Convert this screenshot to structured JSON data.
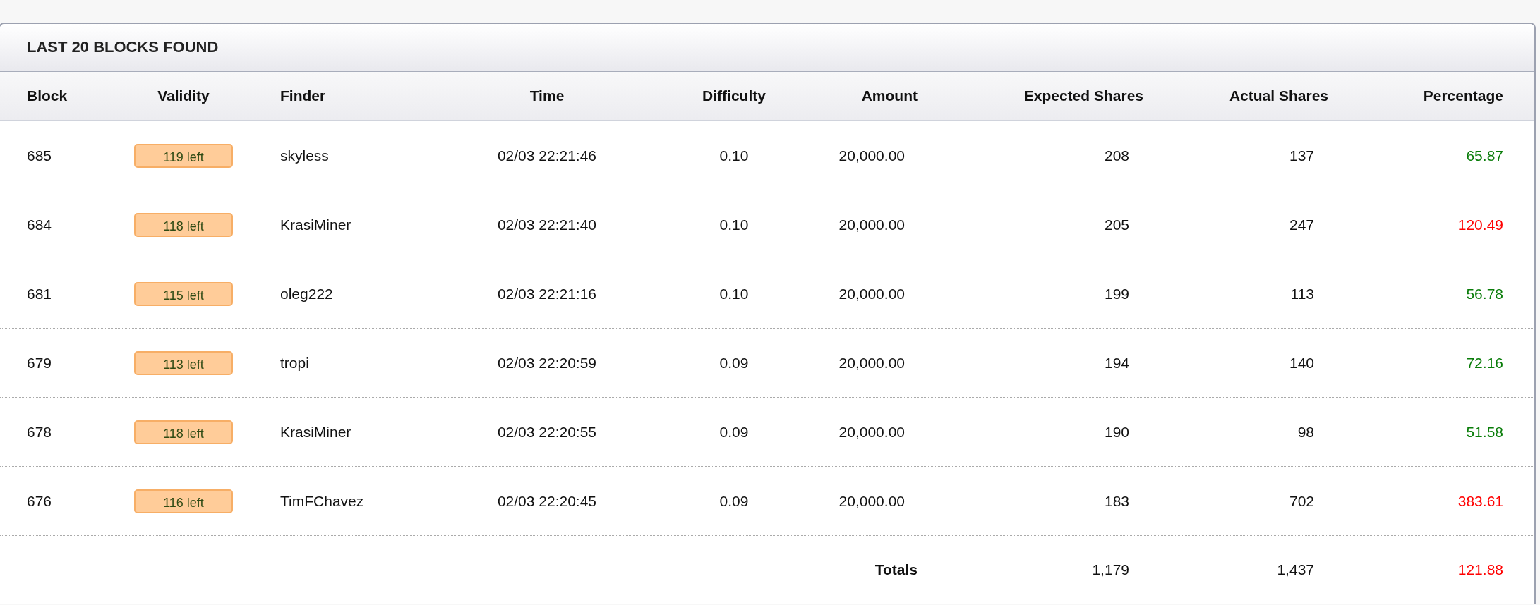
{
  "panel": {
    "title": "LAST 20 BLOCKS FOUND"
  },
  "table": {
    "columns": [
      "Block",
      "Validity",
      "Finder",
      "Time",
      "Difficulty",
      "Amount",
      "Expected Shares",
      "Actual Shares",
      "Percentage"
    ],
    "rows": [
      {
        "block": "685",
        "validity": "119 left",
        "finder": "skyless",
        "time": "02/03 22:21:46",
        "difficulty": "0.10",
        "amount": "20,000.00",
        "expected": "208",
        "actual": "137",
        "percentage": "65.87",
        "color": "#0a7d0a"
      },
      {
        "block": "684",
        "validity": "118 left",
        "finder": "KrasiMiner",
        "time": "02/03 22:21:40",
        "difficulty": "0.10",
        "amount": "20,000.00",
        "expected": "205",
        "actual": "247",
        "percentage": "120.49",
        "color": "#ff0000"
      },
      {
        "block": "681",
        "validity": "115 left",
        "finder": "oleg222",
        "time": "02/03 22:21:16",
        "difficulty": "0.10",
        "amount": "20,000.00",
        "expected": "199",
        "actual": "113",
        "percentage": "56.78",
        "color": "#0a7d0a"
      },
      {
        "block": "679",
        "validity": "113 left",
        "finder": "tropi",
        "time": "02/03 22:20:59",
        "difficulty": "0.09",
        "amount": "20,000.00",
        "expected": "194",
        "actual": "140",
        "percentage": "72.16",
        "color": "#0a7d0a"
      },
      {
        "block": "678",
        "validity": "118 left",
        "finder": "KrasiMiner",
        "time": "02/03 22:20:55",
        "difficulty": "0.09",
        "amount": "20,000.00",
        "expected": "190",
        "actual": "98",
        "percentage": "51.58",
        "color": "#0a7d0a"
      },
      {
        "block": "676",
        "validity": "116 left",
        "finder": "TimFChavez",
        "time": "02/03 22:20:45",
        "difficulty": "0.09",
        "amount": "20,000.00",
        "expected": "183",
        "actual": "702",
        "percentage": "383.61",
        "color": "#ff0000"
      }
    ],
    "totals": {
      "label": "Totals",
      "expected": "1,179",
      "actual": "1,437",
      "percentage": "121.88",
      "color": "#ff0000"
    }
  }
}
